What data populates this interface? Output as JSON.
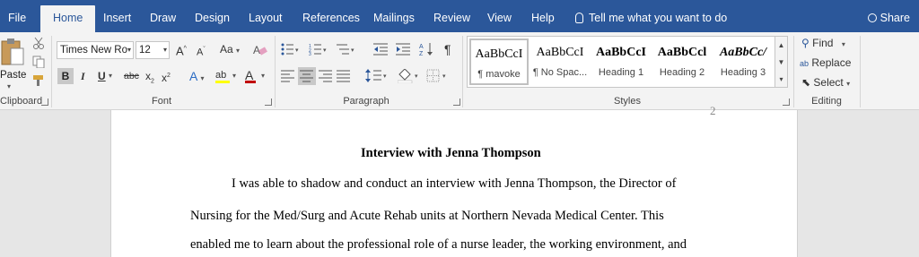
{
  "tabs": [
    "File",
    "Home",
    "Insert",
    "Draw",
    "Design",
    "Layout",
    "References",
    "Mailings",
    "Review",
    "View",
    "Help"
  ],
  "active_tab": "Home",
  "tellme": "Tell me what you want to do",
  "share": "Share",
  "clipboard": {
    "paste": "Paste",
    "label": "Clipboard"
  },
  "font": {
    "name": "Times New Ro",
    "size": "12",
    "label": "Font",
    "grow": "A",
    "shrink": "A",
    "case": "Aa",
    "bold": "B",
    "italic": "I",
    "underline": "U",
    "strike": "abc",
    "sub": "x",
    "super": "x",
    "texteffect": "A",
    "highlight": "ab",
    "fontcolor": "A"
  },
  "paragraph": {
    "label": "Paragraph",
    "pilcrow": "¶"
  },
  "styles": {
    "label": "Styles",
    "items": [
      {
        "sample": "AaBbCcI",
        "name": "¶ mavoke"
      },
      {
        "sample": "AaBbCcI",
        "name": "¶ No Spac..."
      },
      {
        "sample": "AaBbCcI",
        "name": "Heading 1"
      },
      {
        "sample": "AaBbCcl",
        "name": "Heading 2"
      },
      {
        "sample": "AaBbCc/",
        "name": "Heading 3"
      }
    ]
  },
  "editing": {
    "label": "Editing",
    "find": "Find",
    "replace": "Replace",
    "select": "Select"
  },
  "document": {
    "page_number": "2",
    "title": "Interview with Jenna Thompson",
    "lines": [
      "I was able to shadow and conduct an interview with Jenna Thompson, the Director of",
      "Nursing for the Med/Surg and Acute Rehab units at Northern Nevada Medical Center. This",
      "enabled me to learn about the professional role of a nurse leader, the working environment, and"
    ]
  },
  "colors": {
    "ribbon_blue": "#2b579a",
    "font_color_red": "#c00000",
    "highlight_yellow": "#ffff00"
  }
}
